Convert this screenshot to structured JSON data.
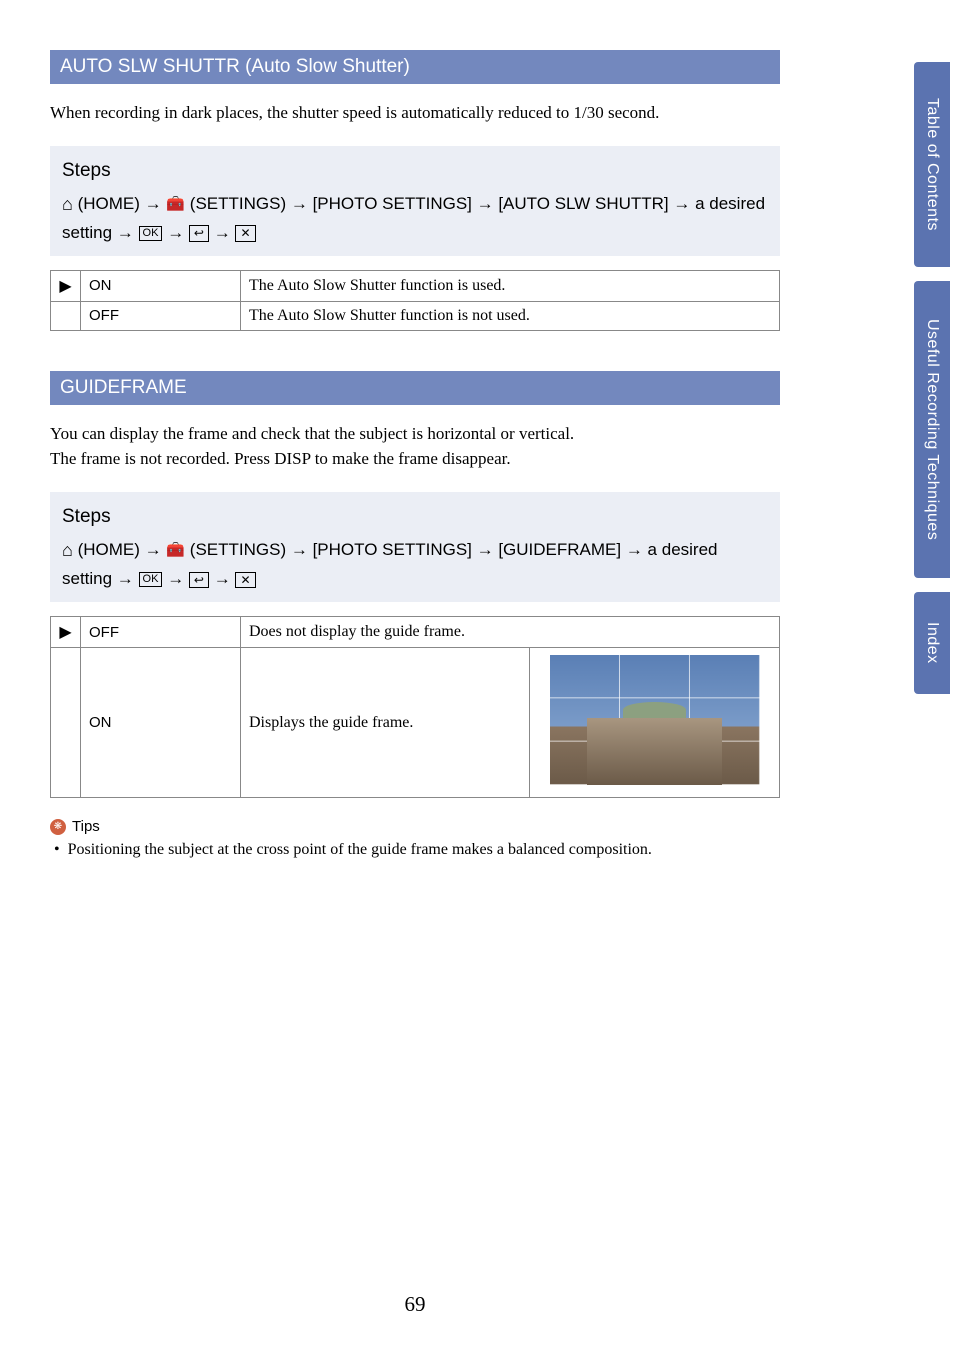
{
  "sections": [
    {
      "header": "AUTO SLW SHUTTR (Auto Slow Shutter)",
      "intro": "When recording in dark places, the shutter speed is automatically reduced to 1/30 second.",
      "steps_title": "Steps",
      "steps_path_prefix": " (HOME) → ",
      "steps_path_mid1": " (SETTINGS) → [PHOTO SETTINGS] → [AUTO SLW SHUTTR] → a desired setting → ",
      "options": [
        {
          "marker": "▶",
          "name": "ON",
          "desc": "The Auto Slow Shutter function is used."
        },
        {
          "marker": "",
          "name": "OFF",
          "desc": "The Auto Slow Shutter function is not used."
        }
      ]
    },
    {
      "header": "GUIDEFRAME",
      "intro": "You can display the frame and check that the subject is horizontal or vertical.",
      "intro2": "The frame is not recorded. Press DISP to make the frame disappear.",
      "steps_title": "Steps",
      "steps_path_prefix": " (HOME) → ",
      "steps_path_mid1": " (SETTINGS) → [PHOTO SETTINGS] → [GUIDEFRAME] → a desired setting → ",
      "options": [
        {
          "marker": "▶",
          "name": "OFF",
          "desc": "Does not display the guide frame."
        },
        {
          "marker": "",
          "name": "ON",
          "desc": "Displays the guide frame.",
          "has_image": true
        }
      ]
    }
  ],
  "tips_label": "Tips",
  "tips_items": [
    "Positioning the subject at the cross point of the guide frame makes a balanced composition."
  ],
  "icons": {
    "home": "⌂",
    "toolbox": "🧰",
    "ok_text": "OK",
    "return_text": "↩",
    "close_text": "✕",
    "arrow": "→",
    "play": "▶",
    "bullet": "•"
  },
  "side_tabs": [
    "Table of Contents",
    "Useful Recording Techniques",
    "Index"
  ],
  "page_number": "69"
}
